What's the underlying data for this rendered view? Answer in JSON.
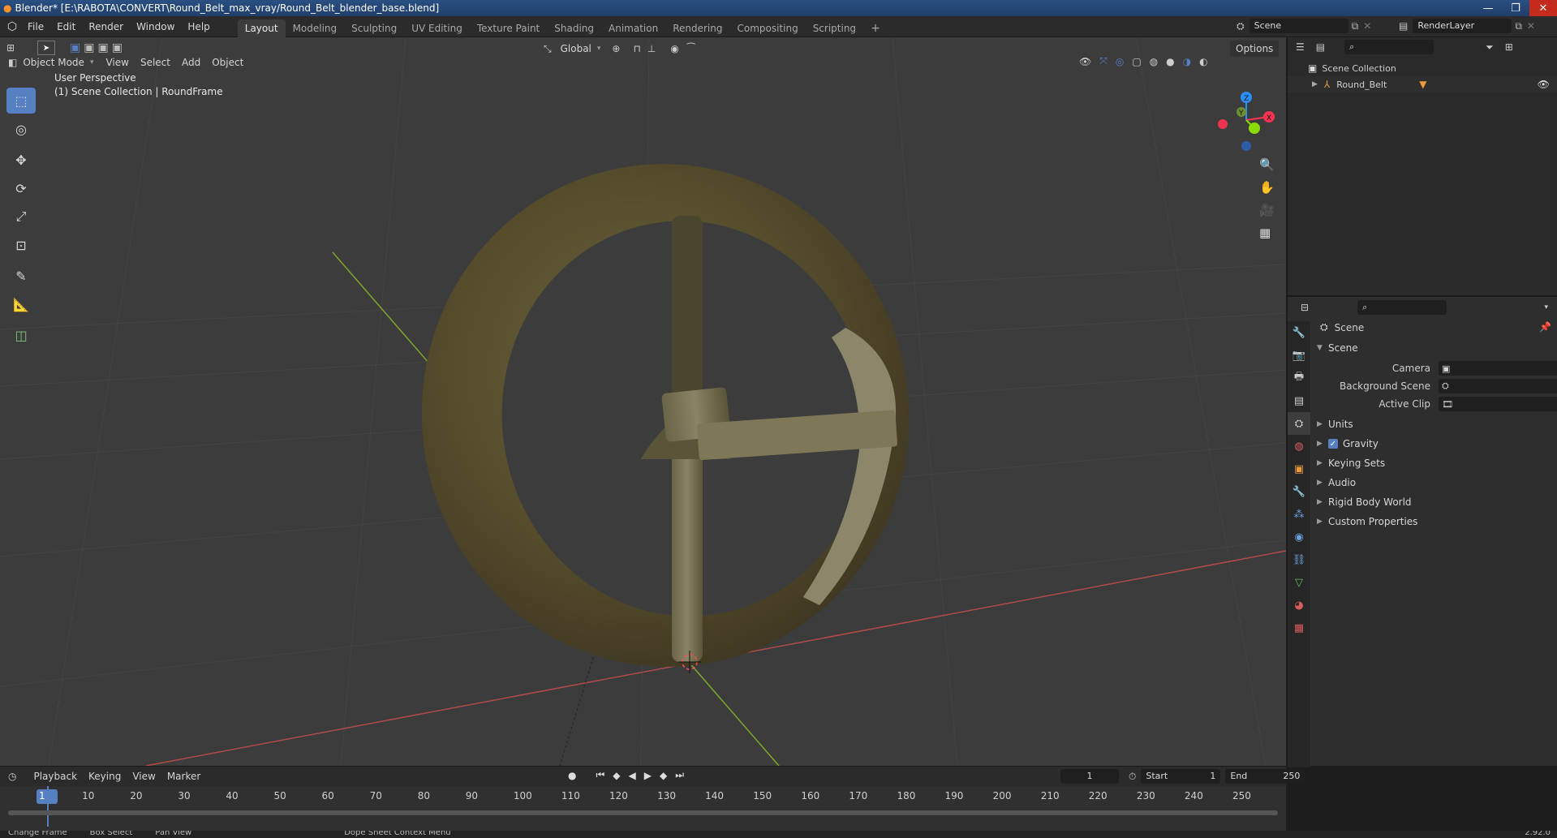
{
  "window": {
    "title": "Blender* [E:\\RABOTA\\CONVERT\\Round_Belt_max_vray/Round_Belt_blender_base.blend]",
    "controls": [
      "—",
      "❐",
      "✕"
    ]
  },
  "menubar": {
    "items": [
      "File",
      "Edit",
      "Render",
      "Window",
      "Help"
    ]
  },
  "workspaces": {
    "tabs": [
      "Layout",
      "Modeling",
      "Sculpting",
      "UV Editing",
      "Texture Paint",
      "Shading",
      "Animation",
      "Rendering",
      "Compositing",
      "Scripting"
    ],
    "active": "Layout",
    "add": "+"
  },
  "scene_selector": {
    "value": "Scene"
  },
  "renderlayer_selector": {
    "value": "RenderLayer"
  },
  "viewport": {
    "transform_orientation": "Global",
    "options_label": "Options",
    "mode": "Object Mode",
    "menus": [
      "View",
      "Select",
      "Add",
      "Object"
    ],
    "overlay_line1": "User Perspective",
    "overlay_line2": "(1) Scene Collection | RoundFrame",
    "gizmo": {
      "x": "X",
      "y": "Y",
      "z": "Z"
    }
  },
  "outliner": {
    "root": "Scene Collection",
    "items": [
      {
        "label": "Round_Belt"
      }
    ]
  },
  "properties": {
    "context": "Scene",
    "panel_scene": "Scene",
    "camera_label": "Camera",
    "background_scene_label": "Background Scene",
    "active_clip_label": "Active Clip",
    "subpanels": [
      "Units",
      "Gravity",
      "Keying Sets",
      "Audio",
      "Rigid Body World",
      "Custom Properties"
    ],
    "gravity_enabled": true
  },
  "timeline": {
    "menus": [
      "Playback",
      "Keying",
      "View",
      "Marker"
    ],
    "current_frame": "1",
    "start_label": "Start",
    "start_value": "1",
    "end_label": "End",
    "end_value": "250",
    "ticks": [
      "1",
      "10",
      "20",
      "30",
      "40",
      "50",
      "60",
      "70",
      "80",
      "90",
      "100",
      "110",
      "120",
      "130",
      "140",
      "150",
      "160",
      "170",
      "180",
      "190",
      "200",
      "210",
      "220",
      "230",
      "240",
      "250"
    ]
  },
  "statusbar": {
    "items": [
      "Change Frame",
      "Box Select",
      "Pan View",
      "Dope Sheet Context Menu"
    ],
    "version": "2.92.0"
  },
  "colors": {
    "accent": "#5680c2",
    "x_axis": "#ff3352",
    "y_axis": "#8bdc00",
    "z_axis": "#2890ff",
    "viewport_bg": "#3c3c3c",
    "belt": "#5a5130"
  }
}
